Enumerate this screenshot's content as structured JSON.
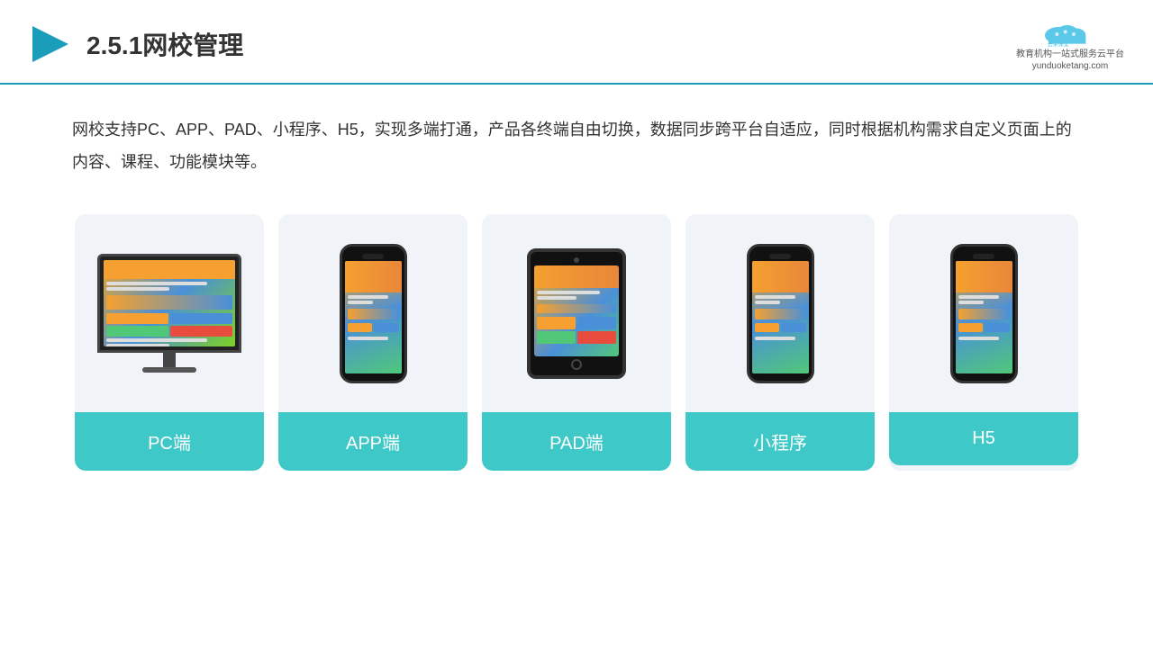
{
  "header": {
    "title": "2.5.1网校管理",
    "brand": {
      "name": "云朵课堂",
      "url": "yunduoketang.com",
      "tagline": "教育机构一站\n式服务云平台"
    }
  },
  "description": "网校支持PC、APP、PAD、小程序、H5，实现多端打通，产品各终端自由切换，数据同步跨平台自适应，同时根据机构需求自定义页面上的内容、课程、功能模块等。",
  "cards": [
    {
      "id": "pc",
      "label": "PC端",
      "device": "pc"
    },
    {
      "id": "app",
      "label": "APP端",
      "device": "phone"
    },
    {
      "id": "pad",
      "label": "PAD端",
      "device": "tablet"
    },
    {
      "id": "miniapp",
      "label": "小程序",
      "device": "phone"
    },
    {
      "id": "h5",
      "label": "H5",
      "device": "phone"
    }
  ],
  "colors": {
    "accent": "#3ec8c8",
    "header_border": "#1a9dbb",
    "title": "#333333",
    "bg_card": "#f0f4f8"
  }
}
